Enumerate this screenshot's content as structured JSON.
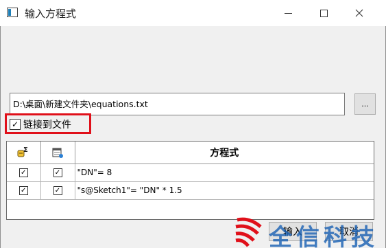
{
  "window": {
    "title": "输入方程式"
  },
  "file": {
    "path": "D:\\桌面\\新建文件夹\\equations.txt",
    "browse_label": "...",
    "link_checked": true,
    "link_label": "链接到文件"
  },
  "grid": {
    "header": {
      "col1_icon": "link-sigma-icon",
      "col2_icon": "calendar-icon",
      "col3": "方程式"
    },
    "rows": [
      {
        "col1_checked": true,
        "col2_checked": true,
        "equation": "\"DN\"= 8"
      },
      {
        "col1_checked": true,
        "col2_checked": true,
        "equation": "\"s@Sketch1\"= \"DN\" * 1.5"
      }
    ]
  },
  "buttons": {
    "ok": "输入",
    "cancel": "取消"
  },
  "watermark": {
    "text": "全信科技",
    "logo_color": "#e0101a",
    "text_color": "#1d63b5"
  },
  "colors": {
    "highlight": "#e0101a"
  }
}
